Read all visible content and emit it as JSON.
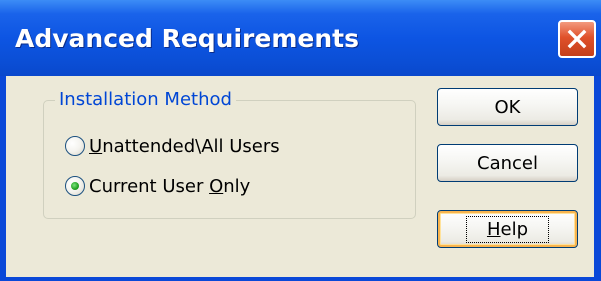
{
  "window": {
    "title": "Advanced Requirements",
    "close_icon": "close-icon"
  },
  "group": {
    "legend": "Installation Method",
    "options": [
      {
        "label": "Unattended\\All Users",
        "mnemonic": "U",
        "rest": "nattended\\All Users",
        "selected": false
      },
      {
        "label": "Current User Only",
        "before": "Current User ",
        "mnemonic": "O",
        "rest": "nly",
        "selected": true
      }
    ]
  },
  "buttons": {
    "ok": "OK",
    "cancel": "Cancel",
    "help": "Help",
    "help_mnemonic": "H",
    "help_rest": "elp"
  },
  "colors": {
    "title_bar": "#0a48d8",
    "dialog_face": "#ece9d8",
    "group_legend": "#0046d5",
    "close_button": "#e0512a",
    "radio_selected": "#21a121"
  }
}
